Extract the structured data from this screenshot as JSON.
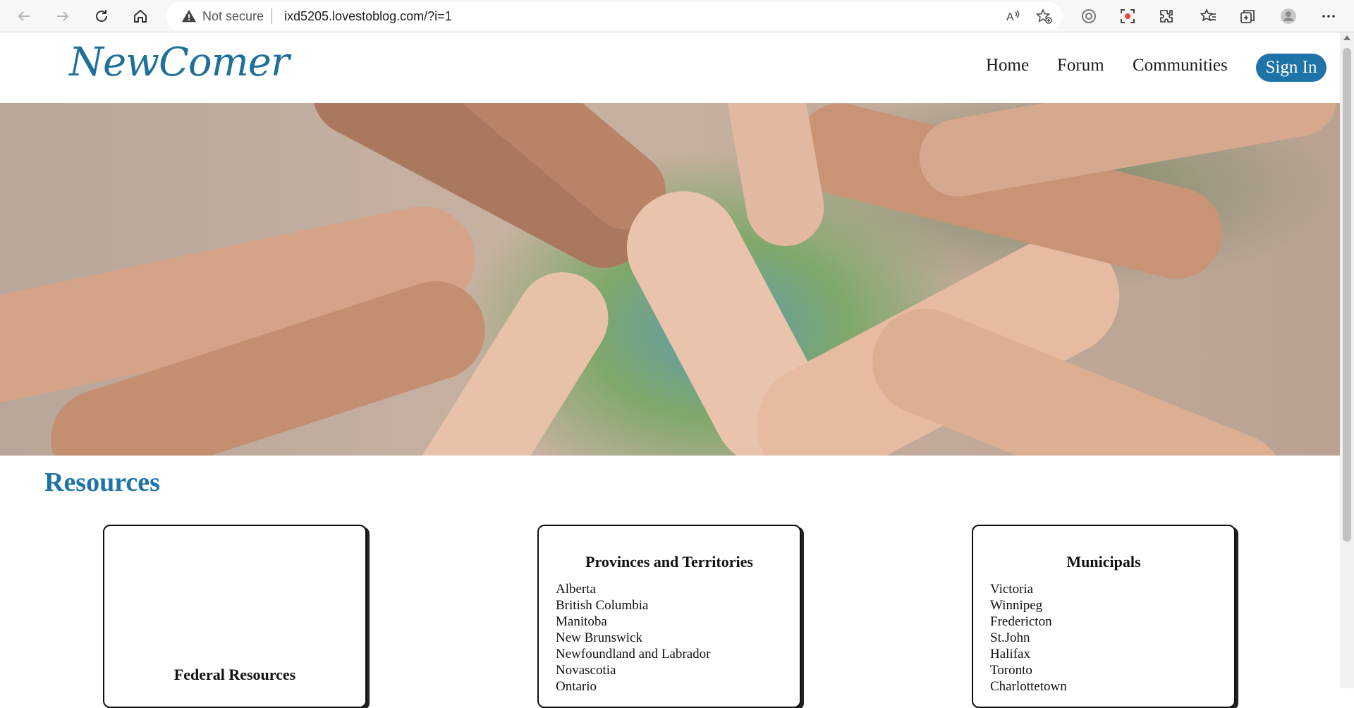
{
  "browser": {
    "security_label": "Not secure",
    "url": "ixd5205.lovestoblog.com/?i=1",
    "read_aloud_text": "A"
  },
  "site": {
    "logo": "NewComer",
    "nav": [
      "Home",
      "Forum",
      "Communities"
    ],
    "sign_in": "Sign In"
  },
  "hero": {
    "alt": "Many hands stacked together over a globe"
  },
  "resources": {
    "title": "Resources",
    "cards": [
      {
        "title": "Federal Resources",
        "items": []
      },
      {
        "title": "Provinces and Territories",
        "items": [
          "Alberta",
          "British Columbia",
          "Manitoba",
          "New Brunswick",
          "Newfoundland and Labrador",
          "Novascotia",
          "Ontario"
        ]
      },
      {
        "title": "Municipals",
        "items": [
          "Victoria",
          "Winnipeg",
          "Fredericton",
          "St.John",
          "Halifax",
          "Toronto",
          "Charlottetown"
        ]
      }
    ]
  },
  "colors": {
    "brand": "#1e73a8",
    "logo": "#1f6f9b"
  },
  "icons": [
    "back-icon",
    "forward-icon",
    "refresh-icon",
    "home-icon",
    "warning-icon",
    "read-aloud-icon",
    "favorite-add-icon",
    "tracking-icon",
    "screenshot-icon",
    "extensions-icon",
    "favorites-icon",
    "collections-icon",
    "profile-icon",
    "more-icon"
  ]
}
